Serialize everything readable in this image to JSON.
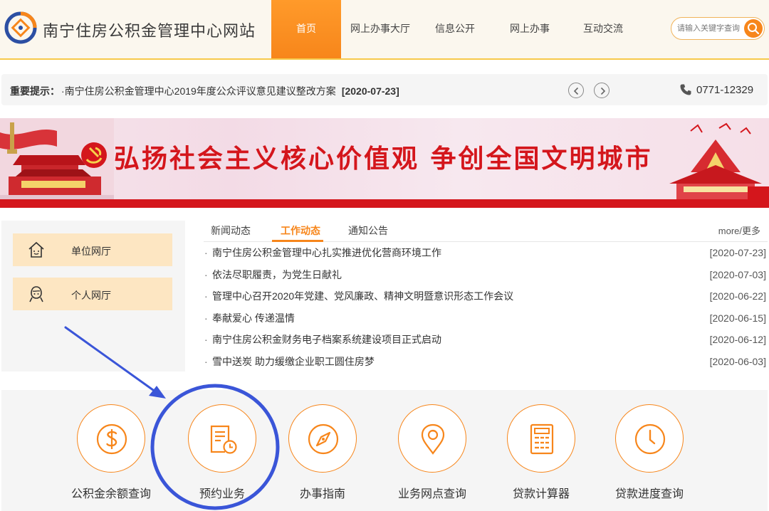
{
  "header": {
    "site_title": "南宁住房公积金管理中心网站",
    "nav": [
      {
        "label": "首页",
        "active": true
      },
      {
        "label": "网上办事大厅",
        "active": false
      },
      {
        "label": "信息公开",
        "active": false
      },
      {
        "label": "网上办事",
        "active": false
      },
      {
        "label": "互动交流",
        "active": false
      }
    ],
    "search_placeholder": "请输入关键字查询"
  },
  "notice": {
    "label": "重要提示：",
    "text": "·南宁住房公积金管理中心2019年度公众评议意见建议整改方案",
    "date": "[2020-07-23]",
    "phone": "0771-12329"
  },
  "banner": {
    "slogan": "弘扬社会主义核心价值观 争创全国文明城市"
  },
  "side_panel": {
    "unit_hall": "单位网厅",
    "personal_hall": "个人网厅"
  },
  "news": {
    "tabs": [
      {
        "label": "新闻动态",
        "active": false
      },
      {
        "label": "工作动态",
        "active": true
      },
      {
        "label": "通知公告",
        "active": false
      }
    ],
    "more": "more/更多",
    "items": [
      {
        "title": "南宁住房公积金管理中心扎实推进优化营商环境工作",
        "date": "[2020-07-23]"
      },
      {
        "title": "依法尽职履责，为党生日献礼",
        "date": "[2020-07-03]"
      },
      {
        "title": "管理中心召开2020年党建、党风廉政、精神文明暨意识形态工作会议",
        "date": "[2020-06-22]"
      },
      {
        "title": "奉献爱心 传递温情",
        "date": "[2020-06-15]"
      },
      {
        "title": "南宁住房公积金财务电子档案系统建设项目正式启动",
        "date": "[2020-06-12]"
      },
      {
        "title": "雪中送炭 助力缓缴企业职工圆住房梦",
        "date": "[2020-06-03]"
      }
    ]
  },
  "services": [
    {
      "label": "公积金余额查询",
      "icon": "dollar-icon"
    },
    {
      "label": "预约业务",
      "icon": "appointment-icon"
    },
    {
      "label": "办事指南",
      "icon": "compass-icon"
    },
    {
      "label": "业务网点查询",
      "icon": "location-pin-icon"
    },
    {
      "label": "贷款计算器",
      "icon": "calculator-icon"
    },
    {
      "label": "贷款进度查询",
      "icon": "clock-icon"
    }
  ],
  "colors": {
    "accent": "#f7861b",
    "banner_red": "#d4161c",
    "annotation_blue": "#3a55d8",
    "side_button_bg": "#fde6c2"
  }
}
